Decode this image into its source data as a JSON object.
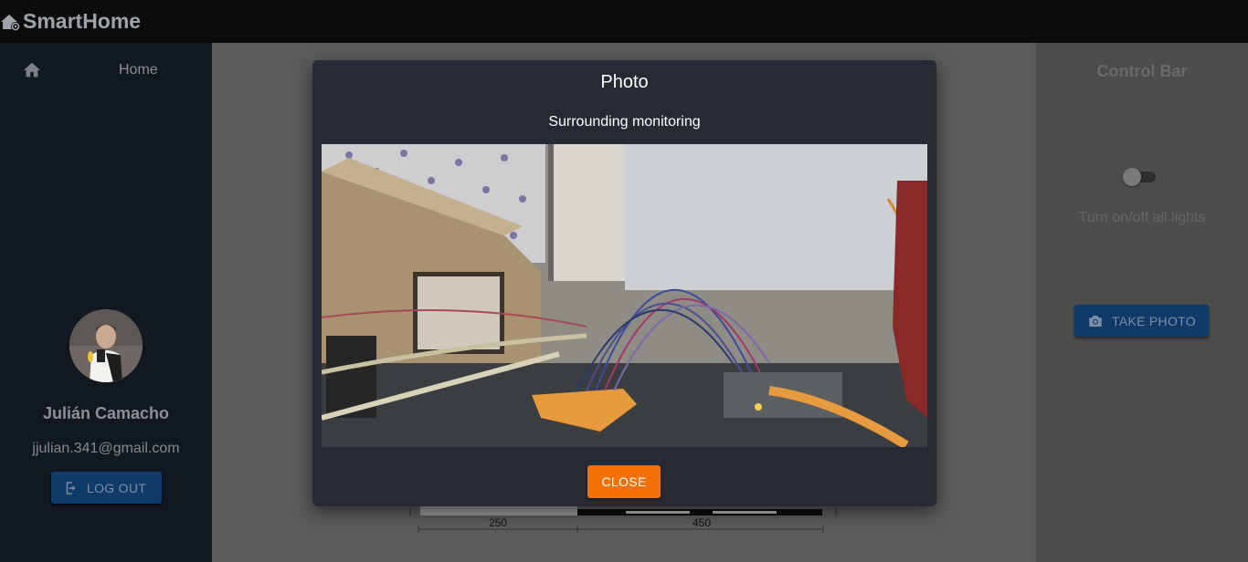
{
  "app": {
    "title": "SmartHome"
  },
  "sidebar": {
    "nav": [
      {
        "label": "Home",
        "icon": "home-icon"
      }
    ],
    "user": {
      "name": "Julián Camacho",
      "email": "jjulian.341@gmail.com"
    },
    "logout_label": "LOG OUT"
  },
  "control_bar": {
    "title": "Control Bar",
    "lights_toggle": {
      "label": "Turn on/off all lights",
      "checked": false
    },
    "take_photo_label": "TAKE PHOTO"
  },
  "diagram": {
    "dimensions": [
      "250",
      "450"
    ]
  },
  "modal": {
    "title": "Photo",
    "subtitle": "Surrounding monitoring",
    "close_label": "CLOSE"
  },
  "colors": {
    "accent": "#f57108",
    "primary_button": "#1565c0",
    "modal_bg": "#262a35",
    "sidebar_bg": "#1c2636"
  }
}
